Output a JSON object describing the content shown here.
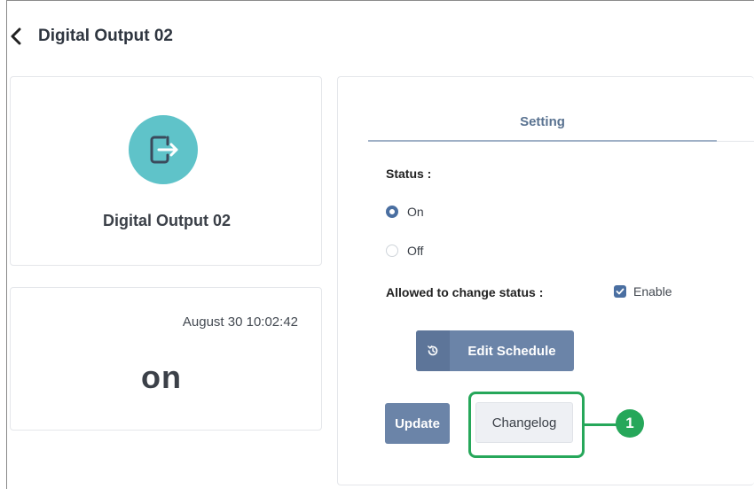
{
  "header": {
    "title": "Digital Output 02"
  },
  "device_card": {
    "name": "Digital Output 02",
    "icon": "exit-door-icon",
    "icon_color": "#5fc3c9"
  },
  "state_card": {
    "timestamp": "August 30 10:02:42",
    "value": "on"
  },
  "setting": {
    "tab_label": "Setting",
    "status_label": "Status :",
    "options": [
      {
        "label": "On",
        "selected": true
      },
      {
        "label": "Off",
        "selected": false
      }
    ],
    "allowed_label": "Allowed to change status :",
    "enable_label": "Enable",
    "enable_checked": true,
    "edit_schedule_label": "Edit Schedule",
    "update_label": "Update",
    "changelog_label": "Changelog"
  },
  "annotation": {
    "badge": "1",
    "color": "#26a75a"
  },
  "colors": {
    "primary_button": "#6b84a8",
    "accent": "#4a6fa1"
  }
}
